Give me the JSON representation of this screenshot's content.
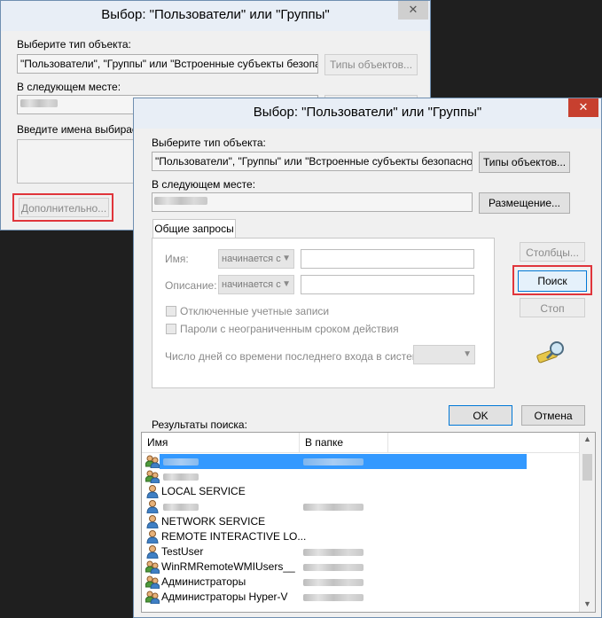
{
  "back_dialog": {
    "title": "Выбор: \"Пользователи\" или \"Группы\"",
    "close_label": "✕",
    "object_type_label": "Выберите тип объекта:",
    "object_type_value": "\"Пользователи\", \"Группы\" или \"Встроенные субъекты безопасн",
    "object_types_button": "Типы объектов...",
    "location_label": "В следующем месте:",
    "enter_names_label": "Введите имена выбираем",
    "advanced_button": "Дополнительно..."
  },
  "front_dialog": {
    "title": "Выбор: \"Пользователи\" или \"Группы\"",
    "close_label": "✕",
    "object_type_label": "Выберите тип объекта:",
    "object_type_value": "\"Пользователи\", \"Группы\" или \"Встроенные субъекты безопасности\"",
    "object_types_button": "Типы объектов...",
    "location_label": "В следующем месте:",
    "location_button": "Размещение...",
    "tab_common_queries": "Общие запросы",
    "name_label": "Имя:",
    "name_mode": "начинается с",
    "description_label": "Описание:",
    "description_mode": "начинается с",
    "disabled_accounts_label": "Отключенные учетные записи",
    "non_expiring_label": "Пароли с неограниченным сроком действия",
    "days_since_login_label": "Число дней со времени последнего входа в систему:",
    "columns_button": "Столбцы...",
    "search_button": "Поиск",
    "stop_button": "Стоп",
    "ok_button": "OK",
    "cancel_button": "Отмена",
    "results_label": "Результаты поиска:",
    "results_columns": {
      "name": "Имя",
      "folder": "В папке"
    },
    "results": [
      {
        "name": "",
        "icon": "group-icon",
        "selected": true,
        "blur_name": true,
        "blur_folder": true
      },
      {
        "name": "",
        "icon": "group-icon",
        "blur_name": true,
        "blur_folder": false
      },
      {
        "name": "LOCAL SERVICE",
        "icon": "user-icon",
        "blur_folder": false
      },
      {
        "name": "",
        "icon": "user-icon",
        "blur_name": true,
        "blur_folder": true
      },
      {
        "name": "NETWORK SERVICE",
        "icon": "user-icon",
        "blur_folder": false
      },
      {
        "name": "REMOTE INTERACTIVE LO...",
        "icon": "user-icon",
        "blur_folder": false
      },
      {
        "name": "TestUser",
        "icon": "user-icon",
        "blur_folder": true
      },
      {
        "name": "WinRMRemoteWMIUsers__",
        "icon": "group-icon",
        "blur_folder": true
      },
      {
        "name": "Администраторы",
        "icon": "group-icon",
        "blur_folder": true
      },
      {
        "name": "Администраторы Hyper-V",
        "icon": "group-icon",
        "blur_folder": true
      }
    ]
  }
}
